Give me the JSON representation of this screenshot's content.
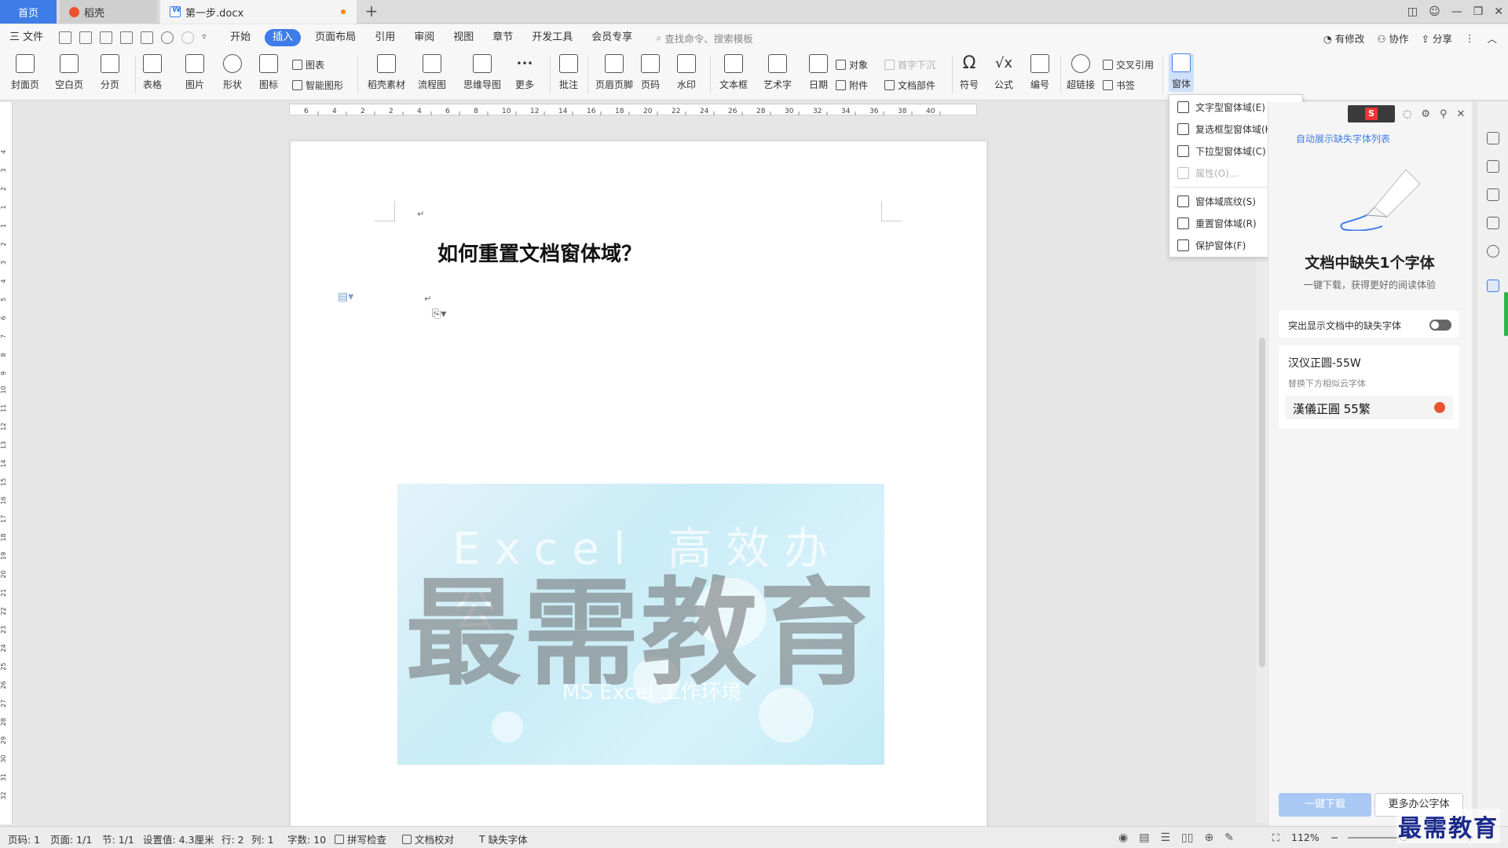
{
  "tabs": {
    "home": "首页",
    "daoke": "稻壳",
    "doc": "第一步.docx"
  },
  "menubar": {
    "file": "三 文件",
    "items": [
      "开始",
      "插入",
      "页面布局",
      "引用",
      "审阅",
      "视图",
      "章节",
      "开发工具",
      "会员专享"
    ],
    "active": "插入",
    "search_placeholder": "查找命令、搜索模板",
    "right": [
      "有修改",
      "协作",
      "分享"
    ]
  },
  "ribbon": {
    "cover": "封面页",
    "blank": "空白页",
    "pagebreak": "分页",
    "table": "表格",
    "picture": "图片",
    "shape": "形状",
    "icon": "图标",
    "chart": "图表",
    "smartart": "智能图形",
    "daoke_material": "稻壳素材",
    "flowchart": "流程图",
    "mindmap": "思维导图",
    "more": "更多",
    "comment": "批注",
    "header_footer": "页眉页脚",
    "page_number": "页码",
    "watermark": "水印",
    "textbox": "文本框",
    "wordart": "艺术字",
    "date": "日期",
    "object": "对象",
    "attachment": "附件",
    "dropcap": "首字下沉",
    "doc_parts": "文档部件",
    "symbol": "符号",
    "formula": "公式",
    "numbering": "编号",
    "hyperlink": "超链接",
    "crossref": "交叉引用",
    "bookmark": "书签",
    "form": "窗体"
  },
  "form_menu": [
    {
      "label": "文字型窗体域(E)",
      "enabled": true
    },
    {
      "label": "复选框型窗体域(H)",
      "enabled": true
    },
    {
      "label": "下拉型窗体域(C)",
      "enabled": true
    },
    {
      "label": "属性(O)...",
      "enabled": false
    },
    {
      "label": "窗体域底纹(S)",
      "enabled": true
    },
    {
      "label": "重置窗体域(R)",
      "enabled": true
    },
    {
      "label": "保护窗体(F)",
      "enabled": true
    }
  ],
  "document": {
    "title": "如何重置文档窗体域？",
    "watermark": "最需教育",
    "banner_sub1": "Excel 高效办公",
    "banner_sub2": "MS Excel 工作环境"
  },
  "ruler_top": [
    "6",
    "4",
    "2",
    "2",
    "4",
    "6",
    "8",
    "10",
    "12",
    "14",
    "16",
    "18",
    "20",
    "22",
    "24",
    "26",
    "28",
    "30",
    "32",
    "34",
    "36",
    "38",
    "40"
  ],
  "ruler_left": [
    "4",
    "3",
    "2",
    "1",
    "1",
    "2",
    "3",
    "4",
    "5",
    "6",
    "7",
    "8",
    "9",
    "10",
    "11",
    "12",
    "13",
    "14",
    "15",
    "16",
    "17",
    "18",
    "19",
    "20",
    "21",
    "22",
    "23",
    "24",
    "25",
    "26",
    "27",
    "28",
    "29",
    "30",
    "31",
    "32"
  ],
  "panel": {
    "auto_show_link": "自动展示缺失字体列表",
    "heading": "文档中缺失1个字体",
    "subheading": "一键下载，获得更好的阅读体验",
    "toggle_label": "突出显示文档中的缺失字体",
    "font_name": "汉仪正圆-55W",
    "replace_hint": "替换下方相似云字体",
    "similar_font": "漢儀正圓 55繁",
    "download_btn": "一键下载",
    "more_btn": "更多办公字体"
  },
  "statusbar": {
    "page_code": "页码: 1",
    "pages": "页面: 1/1",
    "section": "节: 1/1",
    "setting": "设置值: 4.3厘米",
    "row": "行: 2",
    "col": "列: 1",
    "words": "字数: 10",
    "spellcheck": "拼写检查",
    "proofread": "文档校对",
    "missing_font": "缺失字体",
    "zoom": "112%"
  },
  "corner_watermark": "最需教育",
  "colors": {
    "accent": "#3e7ce8",
    "green": "#2fb24a",
    "orange": "#f08a00"
  }
}
